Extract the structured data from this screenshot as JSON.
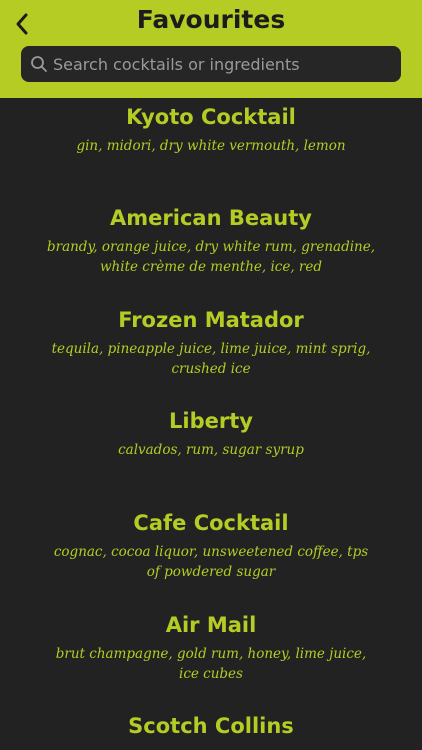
{
  "header": {
    "title": "Favourites",
    "back_icon": "chevron-left-icon"
  },
  "search": {
    "placeholder": "Search cocktails or ingredients",
    "value": "",
    "icon": "search-icon"
  },
  "colors": {
    "accent": "#b5cc24",
    "background": "#222222",
    "search_field": "#262626",
    "title_text": "#1c1c1c"
  },
  "cocktails": [
    {
      "name": "Kyoto Cocktail",
      "ingredients": "gin, midori, dry white vermouth, lemon"
    },
    {
      "name": "American Beauty",
      "ingredients": "brandy, orange juice, dry white rum, grenadine, white crème de menthe, ice, red"
    },
    {
      "name": "Frozen Matador",
      "ingredients": "tequila, pineapple juice, lime juice, mint sprig, crushed ice"
    },
    {
      "name": "Liberty",
      "ingredients": "calvados, rum, sugar syrup"
    },
    {
      "name": "Cafe Cocktail",
      "ingredients": "cognac, cocoa liquor, unsweetened coffee, tps of powdered sugar"
    },
    {
      "name": "Air Mail",
      "ingredients": "brut champagne, gold rum, honey, lime juice, ice cubes"
    },
    {
      "name": "Scotch Collins",
      "ingredients": ""
    }
  ]
}
